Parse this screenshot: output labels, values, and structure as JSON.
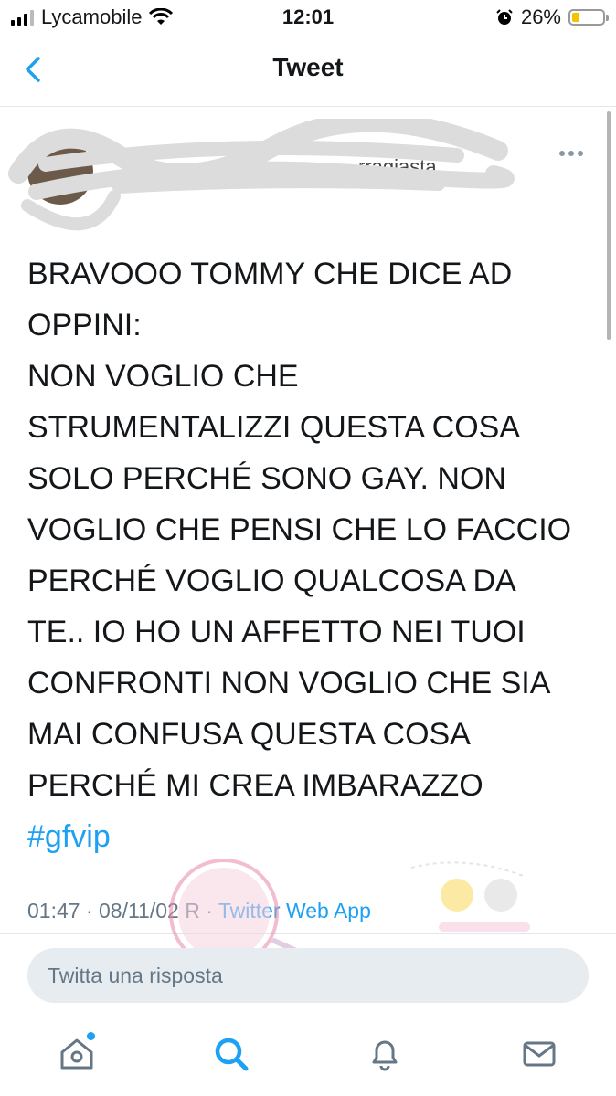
{
  "status_bar": {
    "carrier": "Lycamobile",
    "time": "12:01",
    "battery_percent": "26%",
    "battery_level": 0.26,
    "icons": [
      "signal-icon",
      "wifi-icon",
      "alarm-icon",
      "battery-icon"
    ]
  },
  "nav": {
    "title": "Tweet",
    "back_icon": "chevron-left-icon"
  },
  "tweet": {
    "handle_fragment": "…rragiasta",
    "text_lines": [
      "BRAVOOO TOMMY CHE DICE AD",
      "OPPINI:",
      "NON VOGLIO CHE",
      "STRUMENTALIZZI QUESTA COSA",
      "SOLO PERCHÉ SONO GAY. NON",
      "VOGLIO CHE PENSI CHE LO FACCIO",
      "PERCHÉ VOGLIO QUALCOSA DA",
      "TE.. IO HO UN AFFETTO NEI TUOI",
      "CONFRONTI NON VOGLIO CHE SIA",
      "MAI CONFUSA QUESTA COSA",
      "PERCHÉ MI CREA IMBARAZZO"
    ],
    "hashtag": "#gfvip",
    "meta_time": "01:47 · 08/11/02 R · ",
    "source": "Twitter Web App"
  },
  "reply": {
    "placeholder": "Twitta una risposta"
  },
  "tabbar": {
    "tabs": [
      "home-icon",
      "search-icon",
      "notifications-icon",
      "messages-icon"
    ]
  },
  "colors": {
    "accent": "#1da1f2",
    "muted": "#657786",
    "divider": "#e1e8ed"
  }
}
